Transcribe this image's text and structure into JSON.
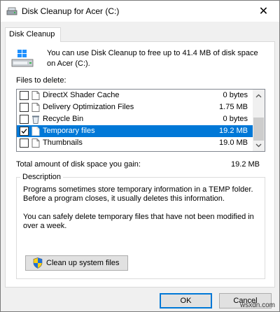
{
  "window": {
    "title": "Disk Cleanup for Acer (C:)"
  },
  "tab": {
    "label": "Disk Cleanup"
  },
  "intro_text": "You can use Disk Cleanup to free up to 41.4 MB of disk space on Acer (C:).",
  "files_label": "Files to delete:",
  "files": [
    {
      "name": "DirectX Shader Cache",
      "size": "0 bytes",
      "checked": false,
      "selected": false,
      "icon": "file-icon"
    },
    {
      "name": "Delivery Optimization Files",
      "size": "1.75 MB",
      "checked": false,
      "selected": false,
      "icon": "file-icon"
    },
    {
      "name": "Recycle Bin",
      "size": "0 bytes",
      "checked": false,
      "selected": false,
      "icon": "recycle-bin-icon"
    },
    {
      "name": "Temporary files",
      "size": "19.2 MB",
      "checked": true,
      "selected": true,
      "icon": "file-icon"
    },
    {
      "name": "Thumbnails",
      "size": "19.0 MB",
      "checked": false,
      "selected": false,
      "icon": "file-icon"
    }
  ],
  "total": {
    "label": "Total amount of disk space you gain:",
    "value": "19.2 MB"
  },
  "description": {
    "legend": "Description",
    "paragraph1": "Programs sometimes store temporary information in a TEMP folder. Before a program closes, it usually deletes this information.",
    "paragraph2": "You can safely delete temporary files that have not been modified in over a week."
  },
  "buttons": {
    "cleanup_system": "Clean up system files",
    "ok": "OK",
    "cancel": "Cancel"
  },
  "watermark": "wsxdn.com",
  "colors": {
    "selection": "#0078d7",
    "accent": "#0078d7"
  }
}
